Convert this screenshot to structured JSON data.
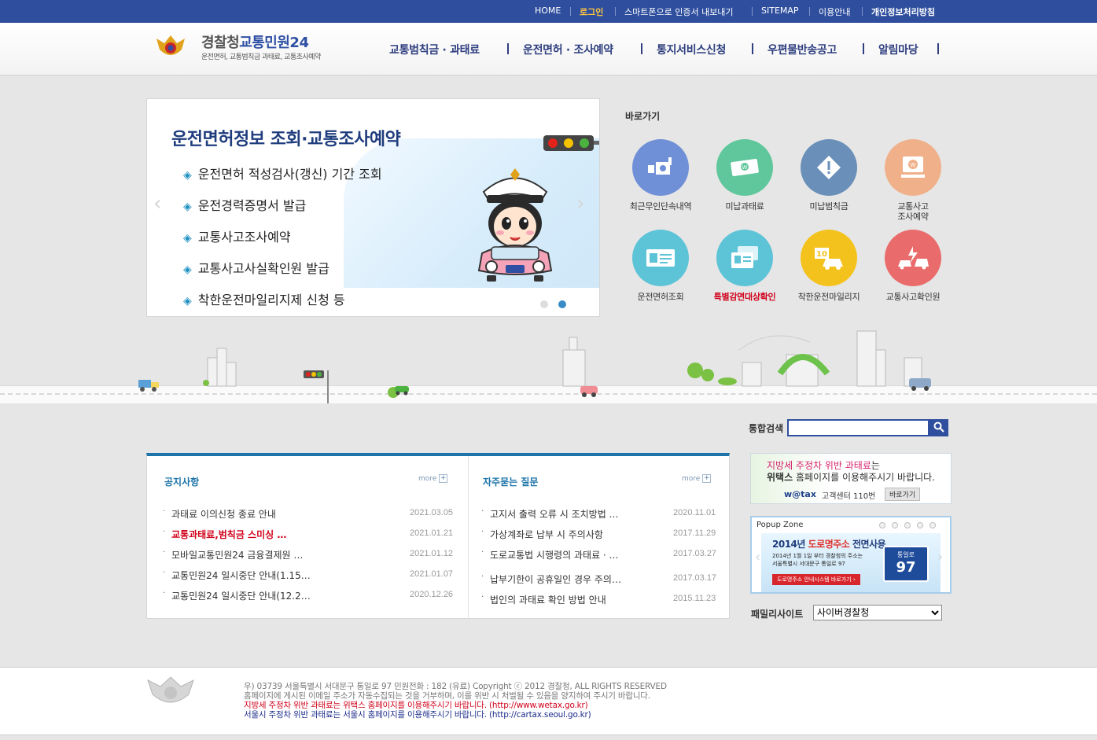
{
  "topbar": {
    "home": "HOME",
    "login": "로그인",
    "smartphone_cert": "스마트폰으로 인증서 내보내기",
    "sitemap": "SITEMAP",
    "guide": "이용안내",
    "privacy": "개인정보처리방침"
  },
  "header": {
    "logo_title_1": "경찰청",
    "logo_title_2": "교통민원24",
    "logo_sub": "운전면허, 교통범칙금 과태료, 교통조사예약",
    "nav": [
      "교통범칙금 · 과태료",
      "운전면허 · 조사예약",
      "통지서비스신청",
      "우편물반송공고",
      "알림마당"
    ]
  },
  "slider": {
    "title": "운전면허정보 조회·교통조사예약",
    "items": [
      "운전면허 적성검사(갱신) 기간 조회",
      "운전경력증명서 발급",
      "교통사고조사예약",
      "교통사고사실확인원 발급",
      "착한운전마일리지제 신청 등"
    ],
    "prev": "‹",
    "next": "›",
    "dot_inactive_color": "#dddddd",
    "dot_active_color": "#3a8cc6"
  },
  "quick": {
    "title": "바로가기",
    "items": [
      {
        "label": "최근무인단속내역",
        "icon": "camera-icon",
        "color": "#6f8fd7"
      },
      {
        "label": "미납과태료",
        "icon": "money-icon",
        "color": "#5fc79b"
      },
      {
        "label": "미납범칙금",
        "icon": "warning-icon",
        "color": "#6a8fb8"
      },
      {
        "label": "교통사고\n조사예약",
        "icon": "computer-icon",
        "color": "#f0b08a"
      },
      {
        "label": "운전면허조회",
        "icon": "license-card-icon",
        "color": "#5dc3d7"
      },
      {
        "label": "특별감면대상확인",
        "icon": "documents-icon",
        "color": "#5dc3d7"
      },
      {
        "label": "착한운전마일리지",
        "icon": "mileage-car-icon",
        "color": "#f4c21c"
      },
      {
        "label": "교통사고확인원",
        "icon": "crash-icon",
        "color": "#e96b6b"
      }
    ]
  },
  "search": {
    "label": "통합검색",
    "value": "",
    "button_icon": "search-icon"
  },
  "notice": {
    "title": "공지사항",
    "more": "more",
    "rows": [
      {
        "title": "과태료 이의신청 종료 안내",
        "date": "2021.03.05",
        "hot": false
      },
      {
        "title": "교통과태료,범칙금 스미싱 …",
        "date": "2021.01.21",
        "hot": true
      },
      {
        "title": "모바일교통민원24 금융결제원 …",
        "date": "2021.01.12",
        "hot": false
      },
      {
        "title": "교통민원24 일시중단 안내(1.15…",
        "date": "2021.01.07",
        "hot": false
      },
      {
        "title": "교통민원24 일시중단 안내(12.2…",
        "date": "2020.12.26",
        "hot": false
      }
    ]
  },
  "faq": {
    "title": "자주묻는 질문",
    "more": "more",
    "rows": [
      {
        "title": "고지서 출력 오류 시 조치방법 …",
        "date": "2020.11.01"
      },
      {
        "title": "가상계좌로 납부 시 주의사항",
        "date": "2017.11.29"
      },
      {
        "title": "도로교통법 시행령의 과태료 · …",
        "date": "2017.03.27"
      },
      {
        "title": "납부기한이 공휴일인 경우 주의…",
        "date": "2017.03.17"
      },
      {
        "title": "법인의 과태료 확인 방법 안내",
        "date": "2015.11.23"
      }
    ]
  },
  "wetax": {
    "line1_pink": "지방세 주정차 위반 과태료",
    "line1_rest": "는",
    "line2_bold": "위택스",
    "line2_rest": " 홈페이지를 이용해주시기 바랍니다.",
    "logo": "w@tax",
    "center": "고객센터 110번",
    "go": "바로가기"
  },
  "popup": {
    "title": "Popup Zone",
    "head_1": "2014년 ",
    "head_red": "도로명주소",
    "head_2": " 전면사용",
    "sub1": "2014년 1월 1일 부터 경찰청의 주소는",
    "sub2": "서울특별시 서대문구 통일로 97",
    "button": "도로명주소 안내시스템 바로가기 ›",
    "sign_top": "통일로",
    "sign_num": "97",
    "prev": "‹",
    "next": "›"
  },
  "family": {
    "label": "패밀리사이트",
    "selected": "사이버경찰청"
  },
  "footer": {
    "line1": "우) 03739 서울특별시 서대문구 통일로 97  민원전화 : 182 (유료)       Copyright ⓒ 2012 경찰청, ALL RIGHTS RESERVED",
    "line2": "홈페이지에 게시된 이메일 주소가 자동수집되는 것을 거부하며, 이를 위반 시 처벌될 수 있음을 양지하여 주시기 바랍니다.",
    "line3": "지방세 주정차 위반 과태료는 위택스 홈페이지를 이용해주시기 바랍니다. (http://www.wetax.go.kr)",
    "line4": "서울시 주정차 위반 과태료는 서울시 홈페이지를 이용해주시기 바랍니다. (http://cartax.seoul.go.kr)"
  }
}
